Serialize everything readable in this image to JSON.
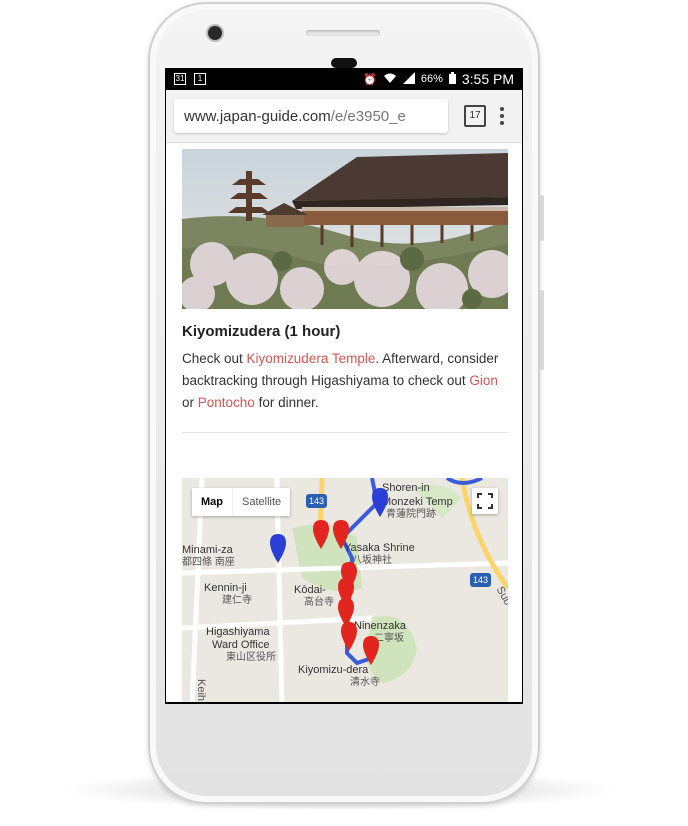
{
  "status_bar": {
    "left_icons": [
      "31",
      "1"
    ],
    "battery": "66%",
    "time": "3:55 PM"
  },
  "browser": {
    "url_domain": "www.japan-guide.com",
    "url_path": "/e/e3950_e",
    "tab_count": "17"
  },
  "article": {
    "heading": "Kiyomizudera (1 hour)",
    "para_part1": "Check out ",
    "link_kiyomizudera": "Kiyomizudera Temple",
    "para_part2": ". Afterward, consider backtracking through Higashiyama to check out ",
    "link_gion": "Gion",
    "para_part3": " or ",
    "link_pontocho": "Pontocho",
    "para_part4": " for dinner."
  },
  "map": {
    "tab_map": "Map",
    "tab_satellite": "Satellite",
    "labels": {
      "shoren": "Shoren-in",
      "monzeki": "Monzeki Temp",
      "shoren_jp": "青蓮院門跡",
      "minamiza": "Minami-za",
      "minamiza_jp": "都四條 南座",
      "yasaka": "Yasaka Shrine",
      "yasaka_jp": "八坂神社",
      "kenninji": "Kennin-ji",
      "kenninji_jp": "建仁寺",
      "kodaiji": "Kōdai-",
      "kodaiji_jp": "高台寺",
      "ninenzaka": "Ninenzaka",
      "ninenzaka_jp": "二寧坂",
      "ward": "Higashiyama",
      "ward2": "Ward Office",
      "ward_jp": "東山区役所",
      "kiyomizu": "Kiyomizu-dera",
      "kiyomizu_jp": "清水寺",
      "road_143": "143",
      "road_143b": "143",
      "sub": "Sub",
      "keih": "Keih"
    }
  },
  "colors": {
    "link": "#d9534f",
    "route": "#3b5bdb",
    "marker_red": "#e3251f",
    "marker_blue": "#2a3fd6"
  }
}
